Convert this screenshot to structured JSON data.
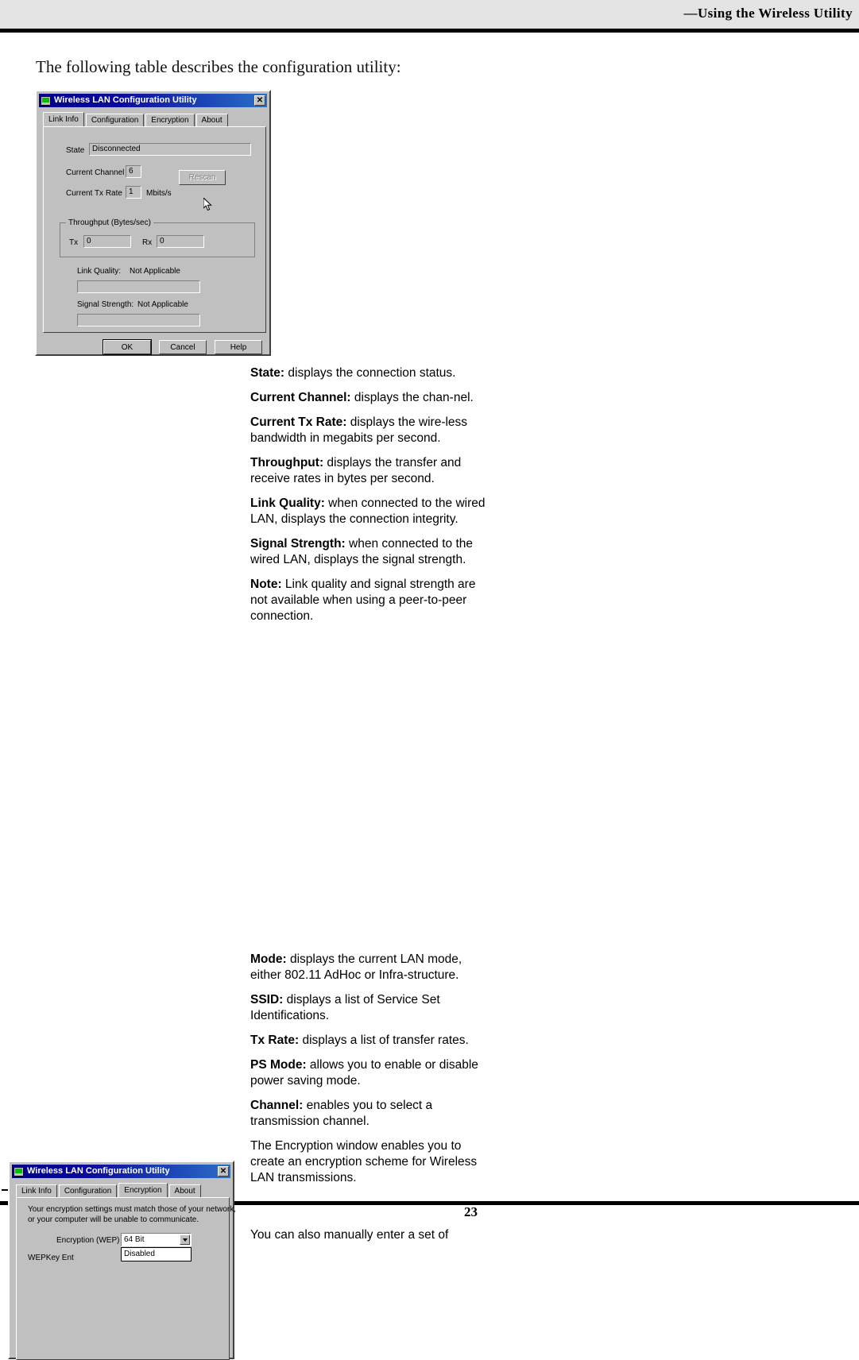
{
  "page": {
    "running_head": "—Using the Wireless Utility",
    "folio": "23",
    "intro": "The following table describes the configuration utility:"
  },
  "dialog1": {
    "title": "Wireless LAN Configuration Utility",
    "close_label": "✕",
    "tabs": [
      {
        "label": "Link Info",
        "active": true
      },
      {
        "label": "Configuration",
        "active": false
      },
      {
        "label": "Encryption",
        "active": false
      },
      {
        "label": "About",
        "active": false
      }
    ],
    "state_label": "State",
    "state_value": "Disconnected",
    "channel_label": "Current Channel",
    "channel_value": "6",
    "txrate_label": "Current Tx Rate",
    "txrate_value": "1",
    "txrate_units": "Mbits/s",
    "rescan_label": "Rescan",
    "throughput_group": "Throughput (Bytes/sec)",
    "tx_label": "Tx",
    "tx_value": "0",
    "rx_label": "Rx",
    "rx_value": "0",
    "link_quality_label": "Link Quality:",
    "link_quality_value": "Not Applicable",
    "signal_strength_label": "Signal Strength:",
    "signal_strength_value": "Not Applicable",
    "ok_label": "OK",
    "cancel_label": "Cancel",
    "help_label": "Help"
  },
  "dialog2": {
    "title": "Wireless LAN Configuration Utility",
    "close_label": "✕",
    "tabs": [
      {
        "label": "Link Info",
        "active": false
      },
      {
        "label": "Configuration",
        "active": false
      },
      {
        "label": "Encryption",
        "active": true
      },
      {
        "label": "About",
        "active": false
      }
    ],
    "notice_line1": "Your encryption settings must match those of your network,",
    "notice_line2": "or your computer will be unable to communicate.",
    "wep_label": "Encryption (WEP)",
    "wep_value": "64 Bit",
    "wep_option_visible": "Disabled",
    "wepkey_label": "WEPKey  Ent"
  },
  "descriptions_top": [
    {
      "term": "State:",
      "text": " displays the connection status."
    },
    {
      "term": "Current Channel:",
      "text": " displays the chan-nel."
    },
    {
      "term": "Current Tx Rate:",
      "text": " displays the wire-less bandwidth in megabits per second."
    },
    {
      "term": "Throughput:",
      "text": " displays the transfer and receive rates in bytes per second."
    },
    {
      "term": "Link Quality:",
      "text": " when connected to the wired LAN, displays the connection integrity."
    },
    {
      "term": "Signal Strength:",
      "text": " when connected to the wired LAN, displays the signal strength."
    },
    {
      "term": "Note:",
      "text": " Link quality and signal strength are not available when using a peer-to-peer connection."
    }
  ],
  "descriptions_bottom": [
    {
      "term": "Mode:",
      "text": " displays the current LAN mode, either 802.11 AdHoc or Infra-structure."
    },
    {
      "term": "SSID:",
      "text": " displays a list of Service Set Identifications."
    },
    {
      "term": "Tx Rate:",
      "text": " displays a list of transfer rates."
    },
    {
      "term": "PS Mode:",
      "text": " allows you to enable or disable power saving mode."
    },
    {
      "term": "Channel:",
      "text": " enables you to select a transmission channel."
    },
    {
      "term": "",
      "text": "The Encryption window enables you to create an encryption scheme for Wireless LAN transmissions."
    },
    {
      "term": "",
      "text": "You can also manually enter a set of"
    }
  ]
}
